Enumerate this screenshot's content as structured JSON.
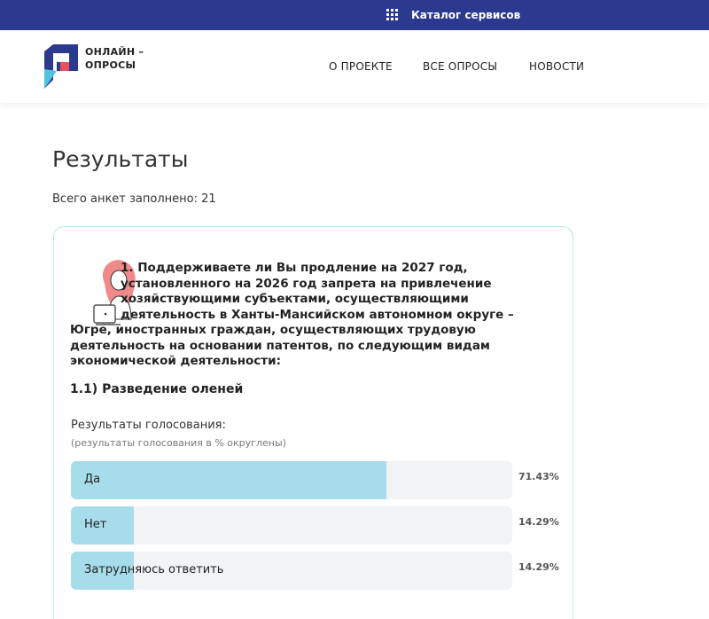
{
  "topbar": {
    "catalog_label": "Каталог сервисов",
    "catalog_icon": "grid-icon",
    "background": "#2b3a8f"
  },
  "header": {
    "logo_line1": "ОНЛАЙН –",
    "logo_line2": "ОПРОСЫ",
    "nav": [
      "О ПРОЕКТЕ",
      "ВСЕ ОПРОСЫ",
      "НОВОСТИ"
    ]
  },
  "main": {
    "title": "Результаты",
    "total": "Всего анкет заполнено: 21"
  },
  "card": {
    "question_lines": [
      "1. Поддерживаете ли Вы продление на 2027 год,",
      "установленного на 2026 год запрета на привлечение",
      "хозяйствующими субъектами, осуществляющими",
      "деятельность в Ханты-Мансийском автономном округе –",
      "Югре, иностранных граждан, осуществляющих трудовую",
      "деятельность на основании патентов, по следующим видам",
      "экономической деятельности:"
    ],
    "subquestion": "1.1) Разведение оленей",
    "results_title": "Результаты голосования:",
    "results_note": "(результаты голосования в % округлены)",
    "options": [
      {
        "label": "Да",
        "percent": "71.43%",
        "value": 71.43
      },
      {
        "label": "Нет",
        "percent": "14.29%",
        "value": 14.29
      },
      {
        "label": "Затрудняюсь ответить",
        "percent": "14.29%",
        "value": 14.29
      }
    ],
    "bar_color": "#a7dcea",
    "accent_border": "#b8ecdf"
  }
}
